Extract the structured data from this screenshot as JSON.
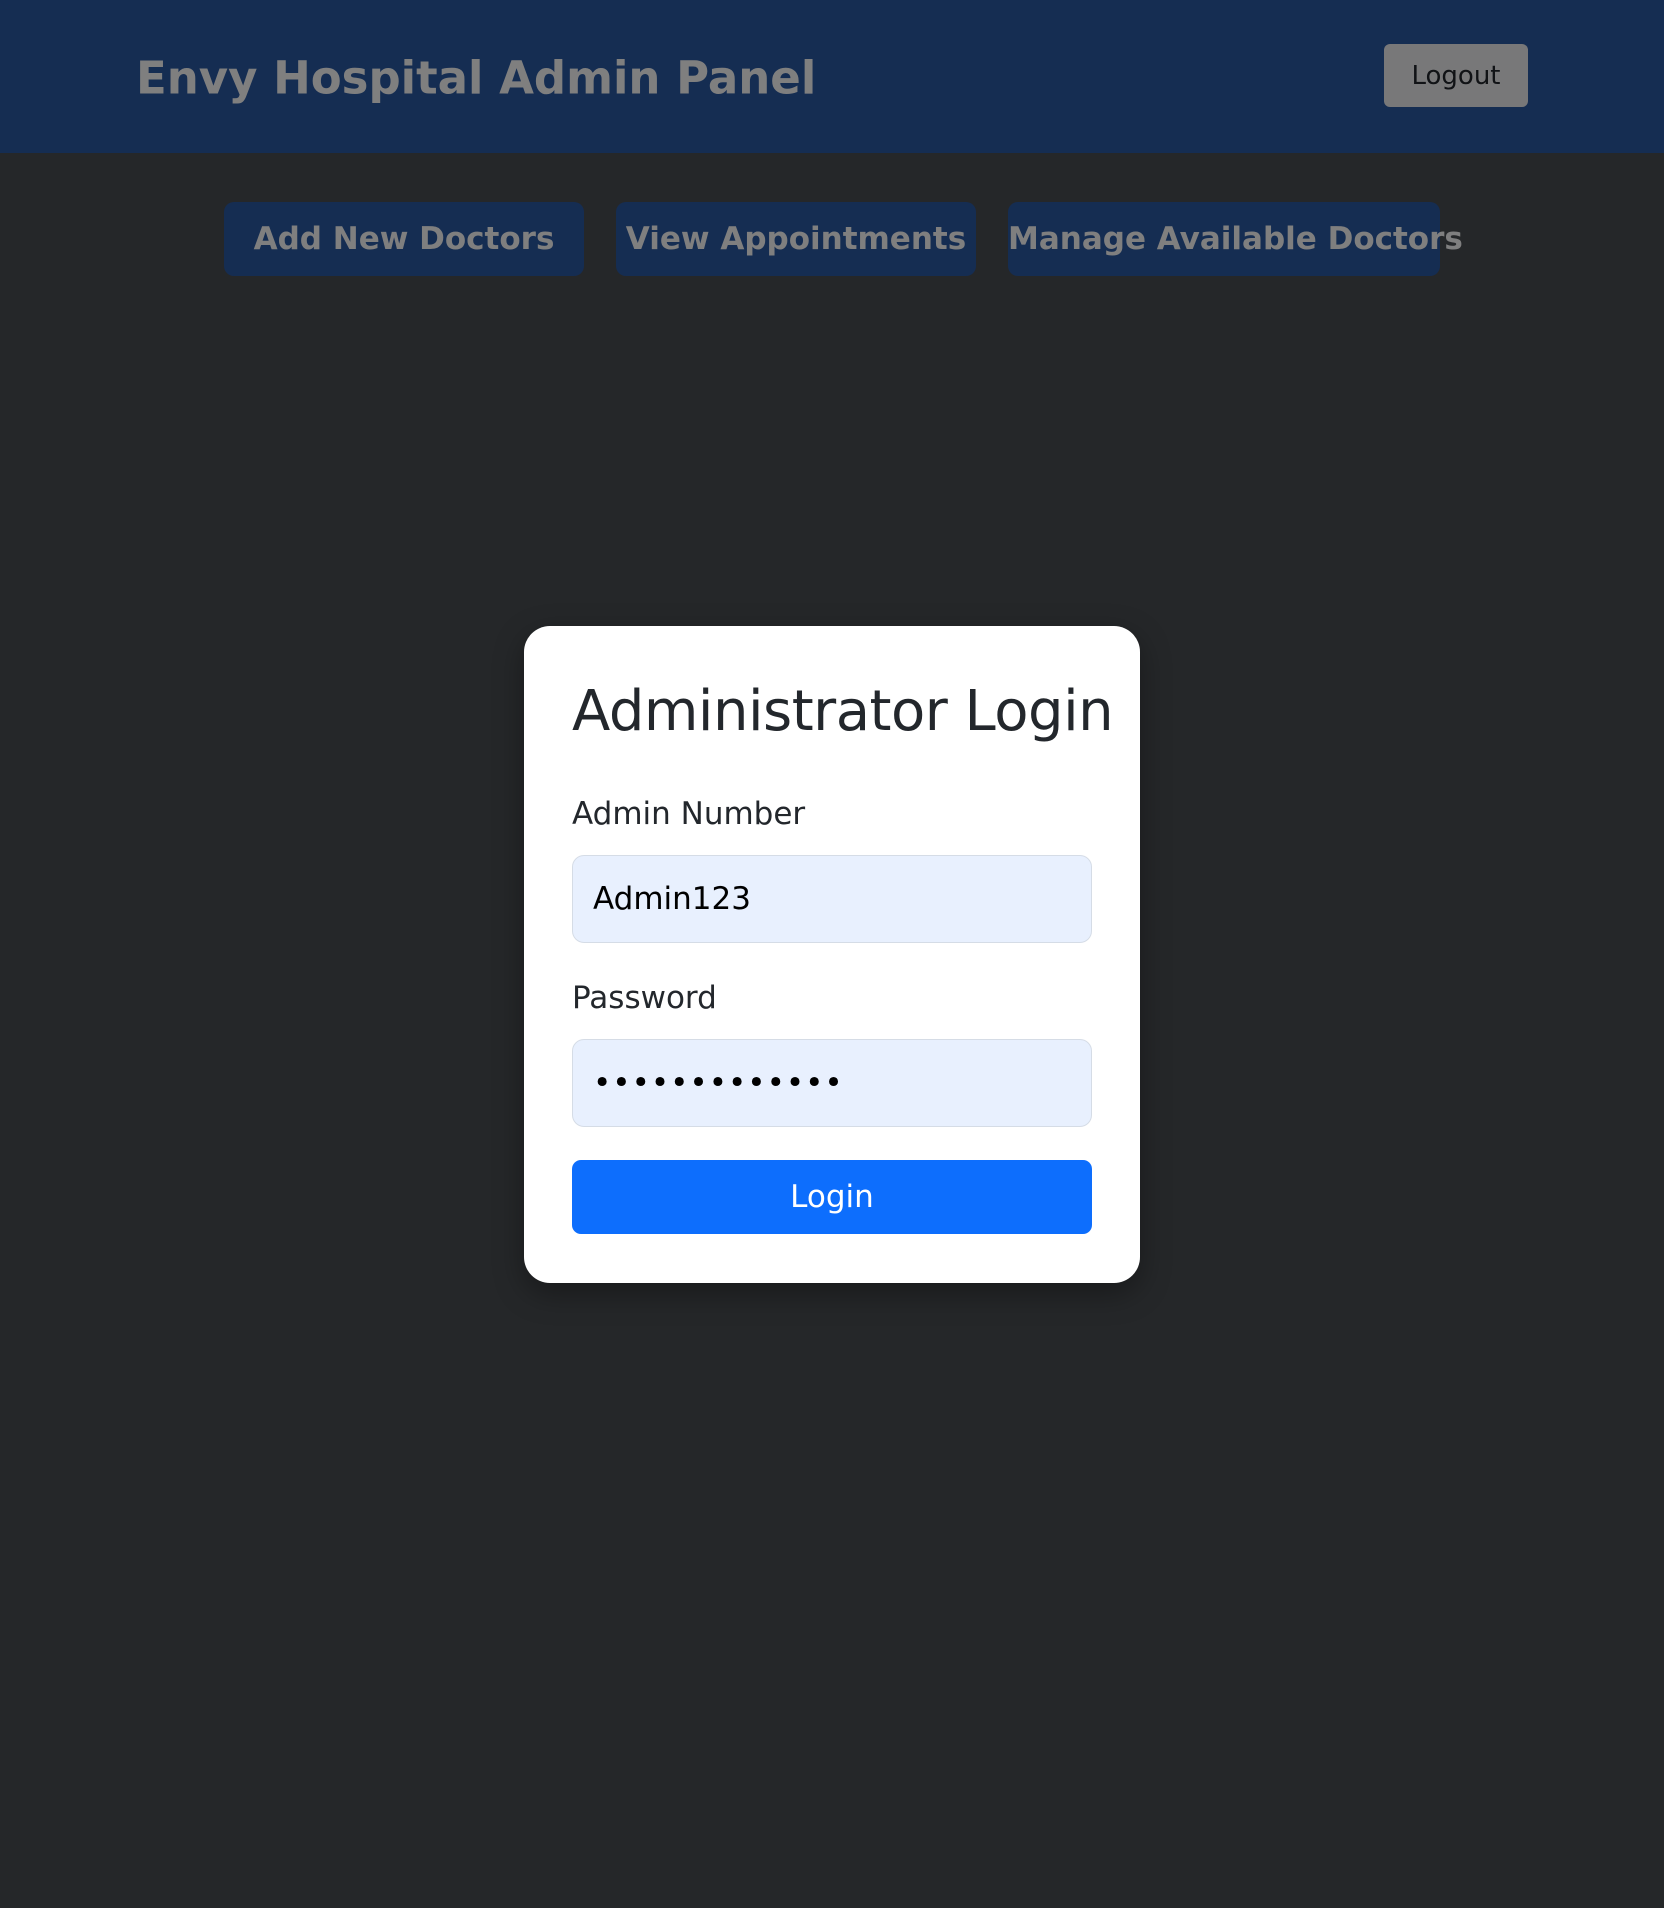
{
  "header": {
    "brand": "Envy Hospital Admin Panel",
    "logout_label": "Logout"
  },
  "nav": {
    "add_doctors": "Add New Doctors",
    "view_appointments": "View Appointments",
    "manage_doctors": "Manage Available Doctors"
  },
  "login_modal": {
    "title": "Administrator Login",
    "admin_number_label": "Admin Number",
    "admin_number_value": "Admin123",
    "password_label": "Password",
    "password_value": "•••••••••••••",
    "login_label": "Login"
  },
  "colors": {
    "header_bg": "#2b5aa5",
    "primary_button": "#0d6efd",
    "input_bg": "#e8f0fe",
    "overlay": "rgba(0,0,0,0.5)"
  }
}
